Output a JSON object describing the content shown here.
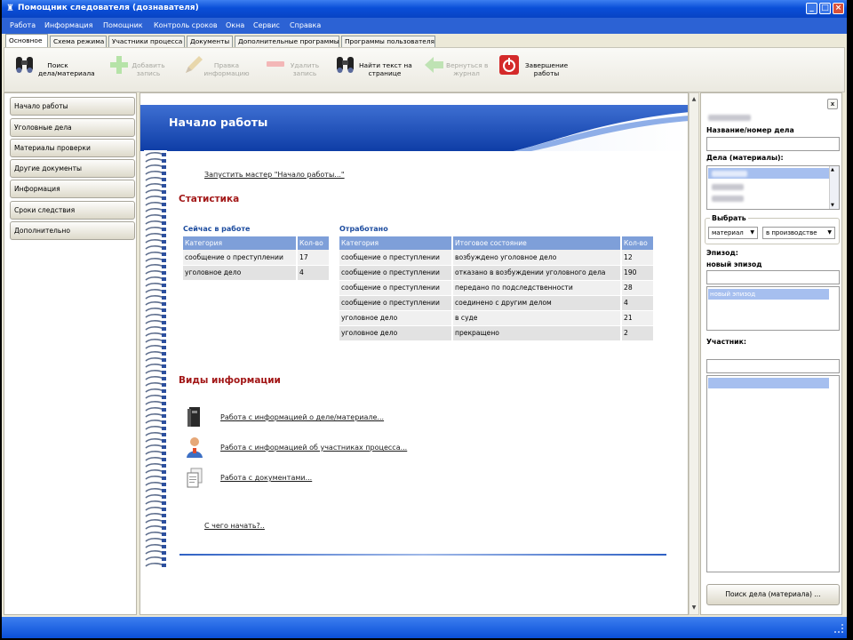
{
  "window": {
    "title": "Помощник следователя (дознавателя)"
  },
  "menu": [
    "Работа",
    "Информация",
    "Помощник",
    "Контроль сроков",
    "Окна",
    "Сервис",
    "Справка"
  ],
  "tabs": [
    "Основное",
    "Схема режима",
    "Участники процесса",
    "Документы",
    "Дополнительные программы",
    "Программы пользователя"
  ],
  "toolbar": {
    "search": [
      "Поиск",
      "дела/материала"
    ],
    "add": [
      "Добавить",
      "запись"
    ],
    "edit": [
      "Правка",
      "информацию"
    ],
    "delete": [
      "Удалить",
      "запись"
    ],
    "find_text": [
      "Найти текст на",
      "странице"
    ],
    "back": [
      "Вернуться в",
      "журнал"
    ],
    "finish": [
      "Завершение",
      "работы"
    ]
  },
  "nav": [
    "Начало работы",
    "Уголовные дела",
    "Материалы проверки",
    "Другие документы",
    "Информация",
    "Сроки следствия",
    "Дополнительно"
  ],
  "main": {
    "banner_title": "Начало работы",
    "wizard_link": "Запустить мастер \"Начало работы...\"",
    "stats_title": "Статистика",
    "current_title": "Сейчас в работе",
    "current_headers": [
      "Категория",
      "Кол-во"
    ],
    "current_rows": [
      [
        "сообщение о преступлении",
        "17"
      ],
      [
        "уголовное дело",
        "4"
      ]
    ],
    "done_title": "Отработано",
    "done_headers": [
      "Категория",
      "Итоговое состояние",
      "Кол-во"
    ],
    "done_rows": [
      [
        "сообщение о преступлении",
        "возбуждено уголовное дело",
        "12"
      ],
      [
        "сообщение о преступлении",
        "отказано в возбуждении уголовного дела",
        "190"
      ],
      [
        "сообщение о преступлении",
        "передано по подследственности",
        "28"
      ],
      [
        "сообщение о преступлении",
        "соединено с другим делом",
        "4"
      ],
      [
        "уголовное дело",
        "в суде",
        "21"
      ],
      [
        "уголовное дело",
        "прекращено",
        "2"
      ]
    ],
    "info_title": "Виды информации",
    "info_links": [
      "Работа с информацией о деле/материале...",
      "Работа с информацией об участниках процесса...",
      "Работа с документами..."
    ],
    "start_link": "С чего начать?.."
  },
  "right": {
    "close": "x",
    "case_label": "Название/номер дела",
    "cases_label": "Дела (материалы):",
    "choose_label": "Выбрать",
    "combo1": "материал",
    "combo2": "в производстве",
    "episode_label": "Эпизод:",
    "episode_value": "новый эпизод",
    "episode_item": "новый эпизод",
    "participant_label": "Участник:",
    "search_button": "Поиск дела (материала) ..."
  }
}
